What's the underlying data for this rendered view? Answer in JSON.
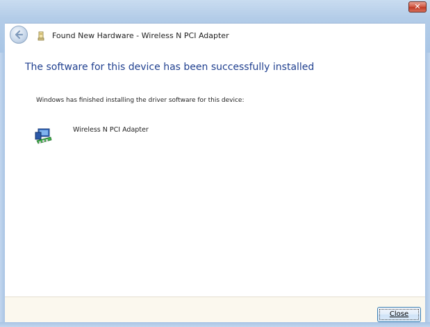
{
  "window": {
    "title": "Found New Hardware - Wireless N PCI Adapter",
    "close_glyph": "✕"
  },
  "content": {
    "heading": "The software for this device has been successfully installed",
    "message": "Windows has finished installing the driver software for this device:",
    "device": {
      "name": "Wireless N PCI Adapter",
      "icon": "network-adapter-icon"
    }
  },
  "footer": {
    "close_label": "Close"
  },
  "colors": {
    "heading": "#1f3f8f",
    "frame": "#a9c6e6",
    "footer_bg": "#fbf8ee"
  }
}
